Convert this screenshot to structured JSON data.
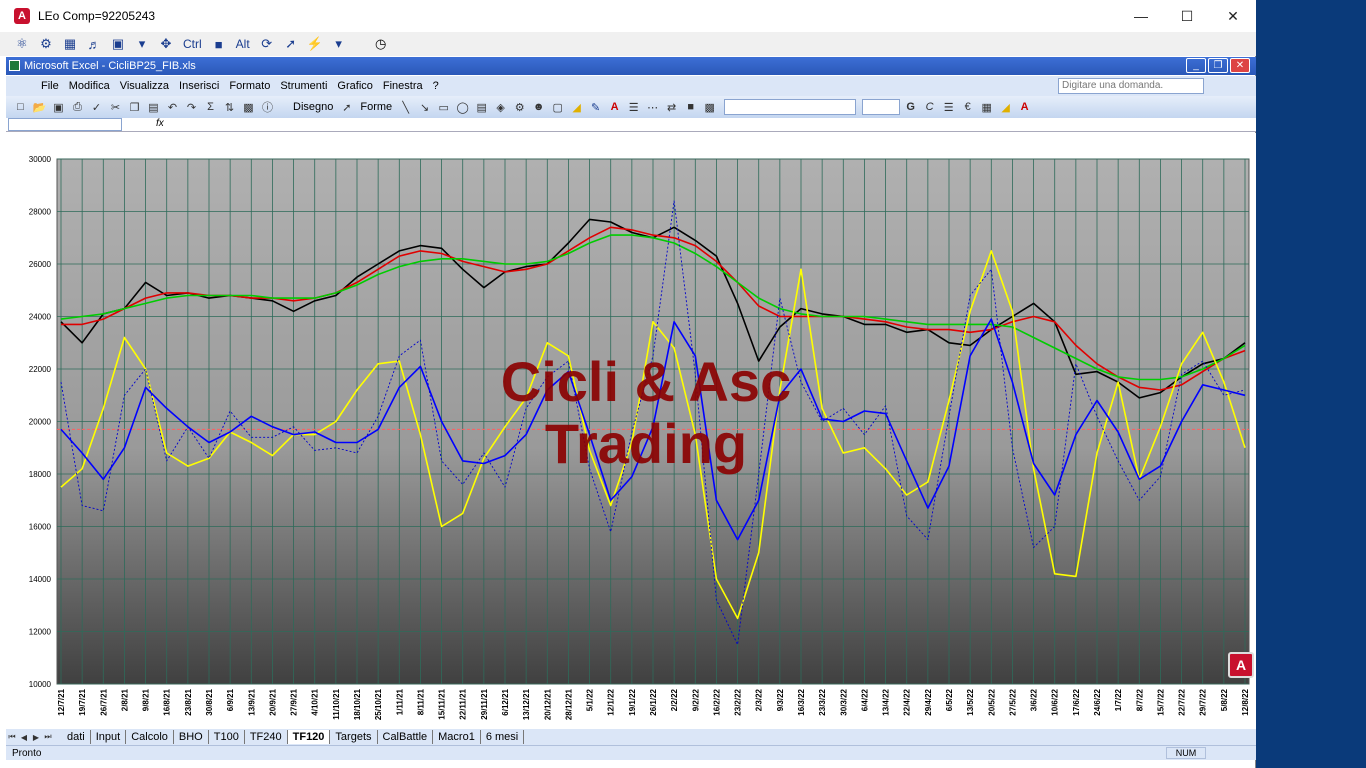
{
  "window": {
    "title": "LEo Comp=92205243",
    "logo_letter": "A"
  },
  "remote_toolbar": {
    "ctrl_label": "Ctrl",
    "alt_label": "Alt"
  },
  "excel": {
    "title": "Microsoft Excel - CicliBP25_FIB.xls",
    "menu": [
      "File",
      "Modifica",
      "Visualizza",
      "Inserisci",
      "Formato",
      "Strumenti",
      "Grafico",
      "Finestra",
      "?"
    ],
    "ask_placeholder": "Digitare una domanda.",
    "draw_label": "Disegno",
    "shapes_label": "Forme",
    "fx_label": "fx",
    "tabs": [
      "dati",
      "Input",
      "Calcolo",
      "BHO",
      "T100",
      "TF240",
      "TF120",
      "Targets",
      "CalBattle",
      "Macro1",
      "6 mesi"
    ],
    "active_tab": "TF120",
    "status": "Pronto",
    "num_indicator": "NUM"
  },
  "watermark": {
    "line1": "Cicli & Asc",
    "line2": "Trading"
  },
  "chart_data": {
    "type": "line",
    "ylim": [
      10000,
      30000
    ],
    "y_ticks": [
      "30000",
      "28000",
      "26000",
      "24000",
      "22000",
      "20000",
      "18000",
      "16000",
      "14000",
      "12000",
      "10000"
    ],
    "x_tick_labels": [
      "12/7/21",
      "19/7/21",
      "26/7/21",
      "2/8/21",
      "9/8/21",
      "16/8/21",
      "23/8/21",
      "30/8/21",
      "6/9/21",
      "13/9/21",
      "20/9/21",
      "27/9/21",
      "4/10/21",
      "11/10/21",
      "18/10/21",
      "25/10/21",
      "1/11/21",
      "8/11/21",
      "15/11/21",
      "22/11/21",
      "29/11/21",
      "6/12/21",
      "13/12/21",
      "20/12/21",
      "28/12/21",
      "5/1/22",
      "12/1/22",
      "19/1/22",
      "26/1/22",
      "2/2/22",
      "9/2/22",
      "16/2/22",
      "23/2/22",
      "2/3/22",
      "9/3/22",
      "16/3/22",
      "23/3/22",
      "30/3/22",
      "6/4/22",
      "13/4/22",
      "22/4/22",
      "29/4/22",
      "6/5/22",
      "13/5/22",
      "20/5/22",
      "27/5/22",
      "3/6/22",
      "10/6/22",
      "17/6/22",
      "24/6/22",
      "1/7/22",
      "8/7/22",
      "15/7/22",
      "22/7/22",
      "29/7/22",
      "5/8/22",
      "12/8/22"
    ],
    "reference_line": 19700,
    "series": [
      {
        "color": "#000000",
        "style": "solid",
        "values": [
          23800,
          23000,
          24100,
          24300,
          25300,
          24800,
          24900,
          24700,
          24800,
          24700,
          24600,
          24200,
          24600,
          24800,
          25500,
          26000,
          26500,
          26700,
          26600,
          25800,
          25100,
          25700,
          25900,
          26000,
          26800,
          27700,
          27600,
          27200,
          27000,
          27400,
          26900,
          26300,
          24500,
          22300,
          23600,
          24300,
          24100,
          24000,
          23700,
          23700,
          23400,
          23500,
          23000,
          22900,
          23500,
          24000,
          24500,
          23800,
          21800,
          21900,
          21500,
          20900,
          21100,
          21700,
          22200,
          22400,
          23000
        ]
      },
      {
        "color": "#e00000",
        "style": "solid",
        "values": [
          23700,
          23700,
          23900,
          24300,
          24700,
          24900,
          24900,
          24800,
          24800,
          24700,
          24700,
          24600,
          24700,
          24900,
          25300,
          25800,
          26300,
          26500,
          26400,
          26100,
          25900,
          25700,
          25800,
          26000,
          26500,
          27000,
          27400,
          27300,
          27100,
          27000,
          26700,
          26100,
          25300,
          24400,
          24000,
          24000,
          24000,
          24000,
          23900,
          23800,
          23600,
          23500,
          23500,
          23400,
          23500,
          23800,
          24000,
          23800,
          22900,
          22200,
          21700,
          21300,
          21200,
          21400,
          21900,
          22400,
          22700
        ]
      },
      {
        "color": "#00cc00",
        "style": "solid",
        "values": [
          23900,
          24000,
          24100,
          24300,
          24500,
          24700,
          24800,
          24800,
          24800,
          24800,
          24700,
          24700,
          24700,
          24900,
          25200,
          25600,
          25900,
          26100,
          26200,
          26200,
          26100,
          26000,
          26000,
          26100,
          26400,
          26800,
          27100,
          27100,
          27000,
          26800,
          26400,
          25900,
          25300,
          24700,
          24300,
          24100,
          24000,
          24000,
          24000,
          23900,
          23800,
          23700,
          23700,
          23700,
          23700,
          23600,
          23200,
          22800,
          22400,
          22000,
          21700,
          21600,
          21600,
          21700,
          22000,
          22400,
          22900
        ]
      },
      {
        "color": "#ffff00",
        "style": "solid",
        "values": [
          17500,
          18200,
          20500,
          23200,
          22000,
          18800,
          18300,
          18600,
          19600,
          19200,
          18700,
          19500,
          19500,
          20000,
          21200,
          22200,
          22300,
          19500,
          16000,
          16500,
          18600,
          19800,
          20900,
          23000,
          22500,
          18900,
          16800,
          19200,
          23800,
          22800,
          19500,
          14000,
          12500,
          15000,
          21200,
          25800,
          20500,
          18800,
          19000,
          18200,
          17200,
          17700,
          20800,
          24200,
          26500,
          24200,
          18200,
          14200,
          14100,
          18800,
          21500,
          17800,
          19800,
          22200,
          23400,
          21500,
          19000
        ]
      },
      {
        "color": "#0000ff",
        "style": "solid",
        "values": [
          19700,
          18800,
          17800,
          19000,
          21300,
          20500,
          19800,
          19200,
          19600,
          20200,
          19800,
          19500,
          19600,
          19200,
          19200,
          19700,
          21300,
          22100,
          20000,
          18500,
          18400,
          18700,
          19500,
          21200,
          21900,
          19500,
          17000,
          17900,
          19800,
          23800,
          22500,
          17000,
          15500,
          17000,
          21000,
          22000,
          20100,
          20000,
          20400,
          20300,
          18500,
          16700,
          18300,
          22500,
          23900,
          21500,
          18400,
          17200,
          19500,
          20800,
          19600,
          17800,
          18300,
          20000,
          21400,
          21200,
          21000
        ]
      },
      {
        "color": "#0000cc",
        "style": "dotted",
        "values": [
          21500,
          16800,
          16600,
          21000,
          22000,
          18500,
          19800,
          18600,
          20400,
          19400,
          19400,
          19800,
          18900,
          19000,
          18800,
          20200,
          22500,
          23100,
          18500,
          17600,
          18800,
          17500,
          20500,
          21700,
          22300,
          18200,
          15800,
          19600,
          22500,
          28400,
          21800,
          13200,
          11500,
          18000,
          24700,
          21500,
          20000,
          20500,
          19500,
          20600,
          16400,
          15500,
          20200,
          24800,
          25800,
          19000,
          15200,
          16000,
          22200,
          20200,
          18500,
          17000,
          17900,
          21800,
          22300,
          21000,
          21200
        ]
      }
    ]
  }
}
